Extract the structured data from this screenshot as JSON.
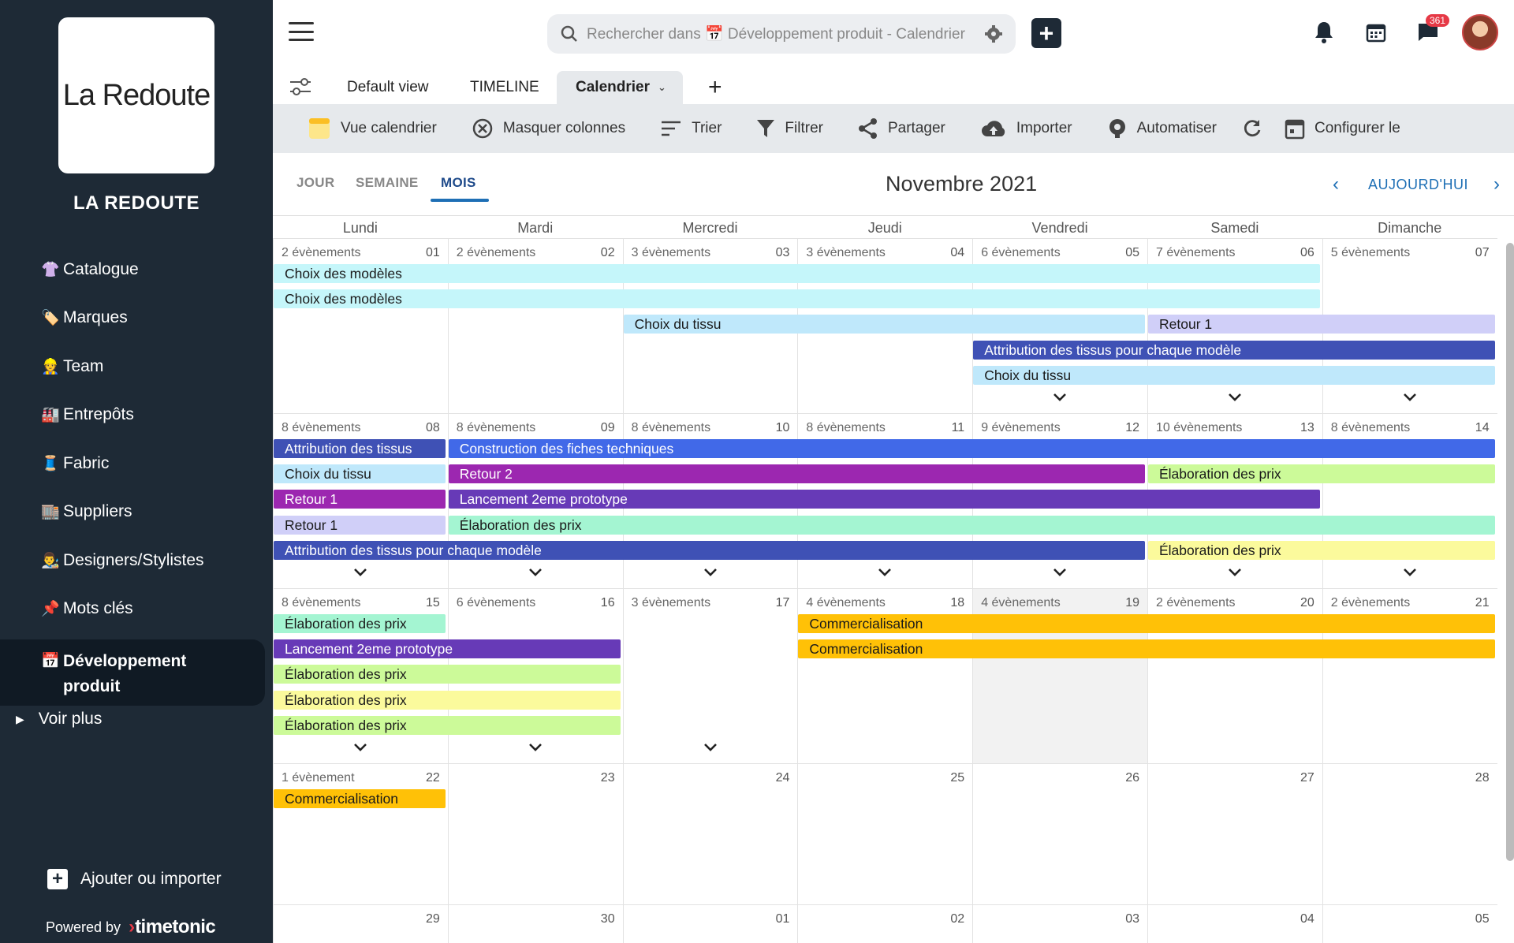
{
  "sidebar": {
    "logo_text": "La Redoute",
    "org_name": "LA REDOUTE",
    "items": [
      {
        "label": "Catalogue",
        "emoji": "👚",
        "icon": "shirt-icon"
      },
      {
        "label": "Marques",
        "emoji": "🏷️",
        "icon": "tag-icon"
      },
      {
        "label": "Team",
        "emoji": "👷",
        "icon": "worker-icon"
      },
      {
        "label": "Entrepôts",
        "emoji": "🏭",
        "icon": "factory-icon"
      },
      {
        "label": "Fabric",
        "emoji": "🧵",
        "icon": "thread-icon"
      },
      {
        "label": "Suppliers",
        "emoji": "🏬",
        "icon": "store-icon"
      },
      {
        "label": "Designers/Stylistes",
        "emoji": "👨‍🎨",
        "icon": "artist-icon"
      },
      {
        "label": "Mots clés",
        "emoji": "📌",
        "icon": "pin-icon"
      },
      {
        "label": "Développement produit",
        "emoji": "📅",
        "icon": "calendar-icon",
        "active": true
      }
    ],
    "voir_plus": "Voir plus",
    "add_import": "Ajouter ou importer",
    "powered_by": "Powered by",
    "brand": "timetonic"
  },
  "header": {
    "search_placeholder": "Rechercher dans 📅 Développement produit - Calendrier",
    "notification_badge": "361"
  },
  "tabs": [
    {
      "label": "Default view"
    },
    {
      "label": "TIMELINE"
    },
    {
      "label": "Calendrier",
      "active": true
    }
  ],
  "toolbar": [
    {
      "label": "Vue calendrier",
      "icon": "calendar-view-icon"
    },
    {
      "label": "Masquer colonnes",
      "icon": "hide-columns-icon"
    },
    {
      "label": "Trier",
      "icon": "sort-icon"
    },
    {
      "label": "Filtrer",
      "icon": "filter-icon"
    },
    {
      "label": "Partager",
      "icon": "share-icon"
    },
    {
      "label": "Importer",
      "icon": "cloud-upload-icon"
    },
    {
      "label": "Automatiser",
      "icon": "automate-icon"
    },
    {
      "label": "",
      "icon": "refresh-icon"
    },
    {
      "label": "Configurer le",
      "icon": "configure-calendar-icon"
    }
  ],
  "view": {
    "modes": [
      "JOUR",
      "SEMAINE",
      "MOIS"
    ],
    "active_mode": "MOIS",
    "month_title": "Novembre 2021",
    "today_label": "AUJOURD'HUI"
  },
  "calendar": {
    "day_names": [
      "Lundi",
      "Mardi",
      "Mercredi",
      "Jeudi",
      "Vendredi",
      "Samedi",
      "Dimanche"
    ],
    "weeks": [
      {
        "days": [
          {
            "num": "01",
            "count": "2 évènements"
          },
          {
            "num": "02",
            "count": "2 évènements"
          },
          {
            "num": "03",
            "count": "3 évènements"
          },
          {
            "num": "04",
            "count": "3 évènements"
          },
          {
            "num": "05",
            "count": "6 évènements"
          },
          {
            "num": "06",
            "count": "7 évènements"
          },
          {
            "num": "07",
            "count": "5 évènements"
          }
        ],
        "more": [
          false,
          false,
          false,
          false,
          true,
          true,
          true
        ],
        "events": [
          {
            "title": "Choix des modèles",
            "start": 0,
            "end": 5,
            "row": 0,
            "color": "#c5f6fa"
          },
          {
            "title": "Choix des modèles",
            "start": 0,
            "end": 5,
            "row": 1,
            "color": "#c5f6fa"
          },
          {
            "title": "Choix du tissu",
            "start": 2,
            "end": 4,
            "row": 2,
            "color": "#bfe8fb"
          },
          {
            "title": "Retour 1",
            "start": 5,
            "end": 6,
            "row": 2,
            "color": "#d0cff8"
          },
          {
            "title": "Attribution des tissus pour chaque modèle",
            "start": 4,
            "end": 6,
            "row": 3,
            "color": "#3f51b5",
            "text": "#ffffff"
          },
          {
            "title": "Choix du tissu",
            "start": 4,
            "end": 6,
            "row": 4,
            "color": "#bfe8fb"
          }
        ]
      },
      {
        "days": [
          {
            "num": "08",
            "count": "8 évènements"
          },
          {
            "num": "09",
            "count": "8 évènements"
          },
          {
            "num": "10",
            "count": "8 évènements"
          },
          {
            "num": "11",
            "count": "8 évènements"
          },
          {
            "num": "12",
            "count": "9 évènements"
          },
          {
            "num": "13",
            "count": "10 évènements"
          },
          {
            "num": "14",
            "count": "8 évènements"
          }
        ],
        "more": [
          true,
          true,
          true,
          true,
          true,
          true,
          true
        ],
        "events": [
          {
            "title": "Attribution des tissus",
            "start": 0,
            "end": 0,
            "row": 0,
            "color": "#3f51b5",
            "text": "#ffffff"
          },
          {
            "title": "Construction des fiches techniques",
            "start": 1,
            "end": 6,
            "row": 0,
            "color": "#4169e8",
            "text": "#ffffff"
          },
          {
            "title": "Choix du tissu",
            "start": 0,
            "end": 0,
            "row": 1,
            "color": "#bfe8fb"
          },
          {
            "title": "Retour 2",
            "start": 1,
            "end": 4,
            "row": 1,
            "color": "#9c27b0",
            "text": "#ffffff"
          },
          {
            "title": "Élaboration des prix",
            "start": 5,
            "end": 6,
            "row": 1,
            "color": "#ccfa99"
          },
          {
            "title": "Retour 1",
            "start": 0,
            "end": 0,
            "row": 2,
            "color": "#9c27b0",
            "text": "#ffffff"
          },
          {
            "title": "Lancement 2eme prototype",
            "start": 1,
            "end": 5,
            "row": 2,
            "color": "#673ab7",
            "text": "#ffffff"
          },
          {
            "title": "Retour 1",
            "start": 0,
            "end": 0,
            "row": 3,
            "color": "#d0cff8"
          },
          {
            "title": "Élaboration des prix",
            "start": 1,
            "end": 6,
            "row": 3,
            "color": "#a4f5d2"
          },
          {
            "title": "Attribution des tissus pour chaque modèle",
            "start": 0,
            "end": 4,
            "row": 4,
            "color": "#3f51b5",
            "text": "#ffffff"
          },
          {
            "title": "Élaboration des prix",
            "start": 5,
            "end": 6,
            "row": 4,
            "color": "#fbfa9c"
          }
        ]
      },
      {
        "days": [
          {
            "num": "15",
            "count": "8 évènements"
          },
          {
            "num": "16",
            "count": "6 évènements"
          },
          {
            "num": "17",
            "count": "3 évènements"
          },
          {
            "num": "18",
            "count": "4 évènements"
          },
          {
            "num": "19",
            "count": "4 évènements",
            "shaded": true
          },
          {
            "num": "20",
            "count": "2 évènements"
          },
          {
            "num": "21",
            "count": "2 évènements"
          }
        ],
        "more": [
          true,
          true,
          true,
          false,
          false,
          false,
          false
        ],
        "events": [
          {
            "title": "Élaboration des prix",
            "start": 0,
            "end": 0,
            "row": 0,
            "color": "#a4f5d2"
          },
          {
            "title": "Commercialisation",
            "start": 3,
            "end": 6,
            "row": 0,
            "color": "#ffc107"
          },
          {
            "title": "Lancement 2eme prototype",
            "start": 0,
            "end": 1,
            "row": 1,
            "color": "#673ab7",
            "text": "#ffffff"
          },
          {
            "title": "Commercialisation",
            "start": 3,
            "end": 6,
            "row": 1,
            "color": "#ffc107"
          },
          {
            "title": "Élaboration des prix",
            "start": 0,
            "end": 1,
            "row": 2,
            "color": "#ccfa99"
          },
          {
            "title": "Élaboration des prix",
            "start": 0,
            "end": 1,
            "row": 3,
            "color": "#fbfa9c"
          },
          {
            "title": "Élaboration des prix",
            "start": 0,
            "end": 1,
            "row": 4,
            "color": "#ccfa99"
          }
        ]
      },
      {
        "days": [
          {
            "num": "22",
            "count": "1 évènement"
          },
          {
            "num": "23",
            "count": ""
          },
          {
            "num": "24",
            "count": ""
          },
          {
            "num": "25",
            "count": ""
          },
          {
            "num": "26",
            "count": ""
          },
          {
            "num": "27",
            "count": ""
          },
          {
            "num": "28",
            "count": ""
          }
        ],
        "more": [
          false,
          false,
          false,
          false,
          false,
          false,
          false
        ],
        "events": [
          {
            "title": "Commercialisation",
            "start": 0,
            "end": 0,
            "row": 0,
            "color": "#ffc107"
          }
        ]
      },
      {
        "days": [
          {
            "num": "29",
            "count": ""
          },
          {
            "num": "30",
            "count": ""
          },
          {
            "num": "01",
            "count": ""
          },
          {
            "num": "02",
            "count": ""
          },
          {
            "num": "03",
            "count": ""
          },
          {
            "num": "04",
            "count": ""
          },
          {
            "num": "05",
            "count": ""
          }
        ],
        "more": [
          false,
          false,
          false,
          false,
          false,
          false,
          false
        ],
        "events": []
      }
    ]
  }
}
